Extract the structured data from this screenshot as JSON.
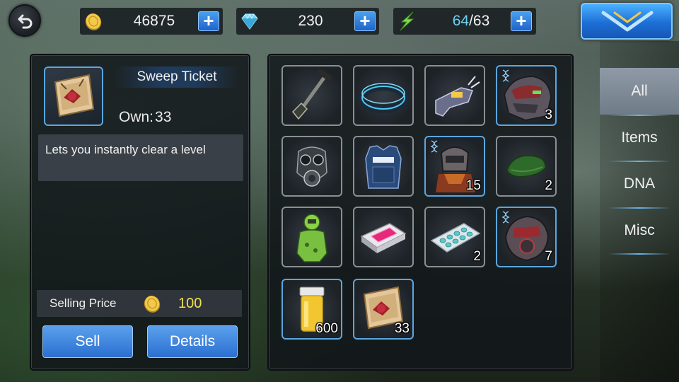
{
  "topbar": {
    "gold": "46875",
    "diamonds": "230",
    "energy_current": "64",
    "energy_sep": "/",
    "energy_max": "63",
    "plus": "+"
  },
  "detail": {
    "item_name": "Sweep Ticket",
    "own_label": "Own:",
    "own_value": "33",
    "description": "Lets you instantly clear a level",
    "selling_price_label": "Selling Price",
    "selling_price_value": "100",
    "sell_label": "Sell",
    "details_label": "Details"
  },
  "tabs": [
    {
      "label": "All"
    },
    {
      "label": "Items"
    },
    {
      "label": "DNA"
    },
    {
      "label": "Misc"
    }
  ],
  "inventory": [
    {
      "icon": "shovel-icon",
      "count": ""
    },
    {
      "icon": "bracelet-icon",
      "count": ""
    },
    {
      "icon": "taser-icon",
      "count": ""
    },
    {
      "icon": "armor-dna-icon",
      "count": "3",
      "dna": true
    },
    {
      "icon": "gas-mask-icon",
      "count": ""
    },
    {
      "icon": "police-vest-icon",
      "count": ""
    },
    {
      "icon": "soldier-dna-icon",
      "count": "15",
      "dna": true
    },
    {
      "icon": "beret-icon",
      "count": "2"
    },
    {
      "icon": "hazmat-suit-icon",
      "count": ""
    },
    {
      "icon": "data-card-icon",
      "count": ""
    },
    {
      "icon": "pills-icon",
      "count": "2"
    },
    {
      "icon": "mech-dna-icon",
      "count": "7",
      "dna": true
    },
    {
      "icon": "serum-vial-icon",
      "count": "600"
    },
    {
      "icon": "sweep-ticket-icon",
      "count": "33"
    }
  ],
  "colors": {
    "accent_blue": "#2b6fd0",
    "price_yellow": "#f4e04a",
    "energy_cyan": "#6fd0f0",
    "dna_border": "#5aa6e0"
  }
}
